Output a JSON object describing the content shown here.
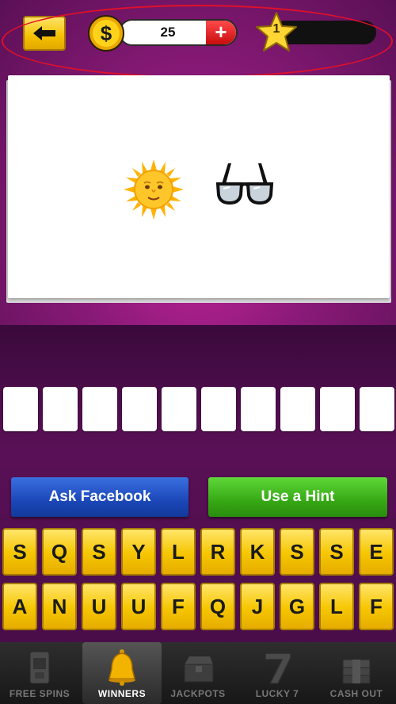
{
  "top_bar": {
    "coins": "25",
    "plus_symbol": "+",
    "coin_symbol": "$",
    "level": "1"
  },
  "puzzle": {
    "emojis": [
      "sun-with-face",
      "eyeglasses"
    ]
  },
  "answer": {
    "box_count": 10
  },
  "actions": {
    "ask_facebook": "Ask Facebook",
    "use_hint": "Use a Hint"
  },
  "keyboard": {
    "row1": [
      "S",
      "Q",
      "S",
      "Y",
      "L",
      "R",
      "K",
      "S",
      "S",
      "E"
    ],
    "row2": [
      "A",
      "N",
      "U",
      "U",
      "F",
      "Q",
      "J",
      "G",
      "L",
      "F"
    ]
  },
  "nav": {
    "items": [
      {
        "label": "FREE SPINS",
        "icon": "slot-machine-icon",
        "active": false
      },
      {
        "label": "WINNERS",
        "icon": "bell-icon",
        "active": true
      },
      {
        "label": "JACKPOTS",
        "icon": "treasure-chest-icon",
        "active": false
      },
      {
        "label": "LUCKY 7",
        "icon": "seven-icon",
        "active": false
      },
      {
        "label": "CASH OUT",
        "icon": "cash-stack-icon",
        "active": false
      }
    ]
  },
  "colors": {
    "key_yellow": "#f6c600",
    "facebook_blue": "#1b47b8",
    "hint_green": "#36a814",
    "background_purple": "#8a1a78",
    "highlight_red": "#e0102a"
  }
}
